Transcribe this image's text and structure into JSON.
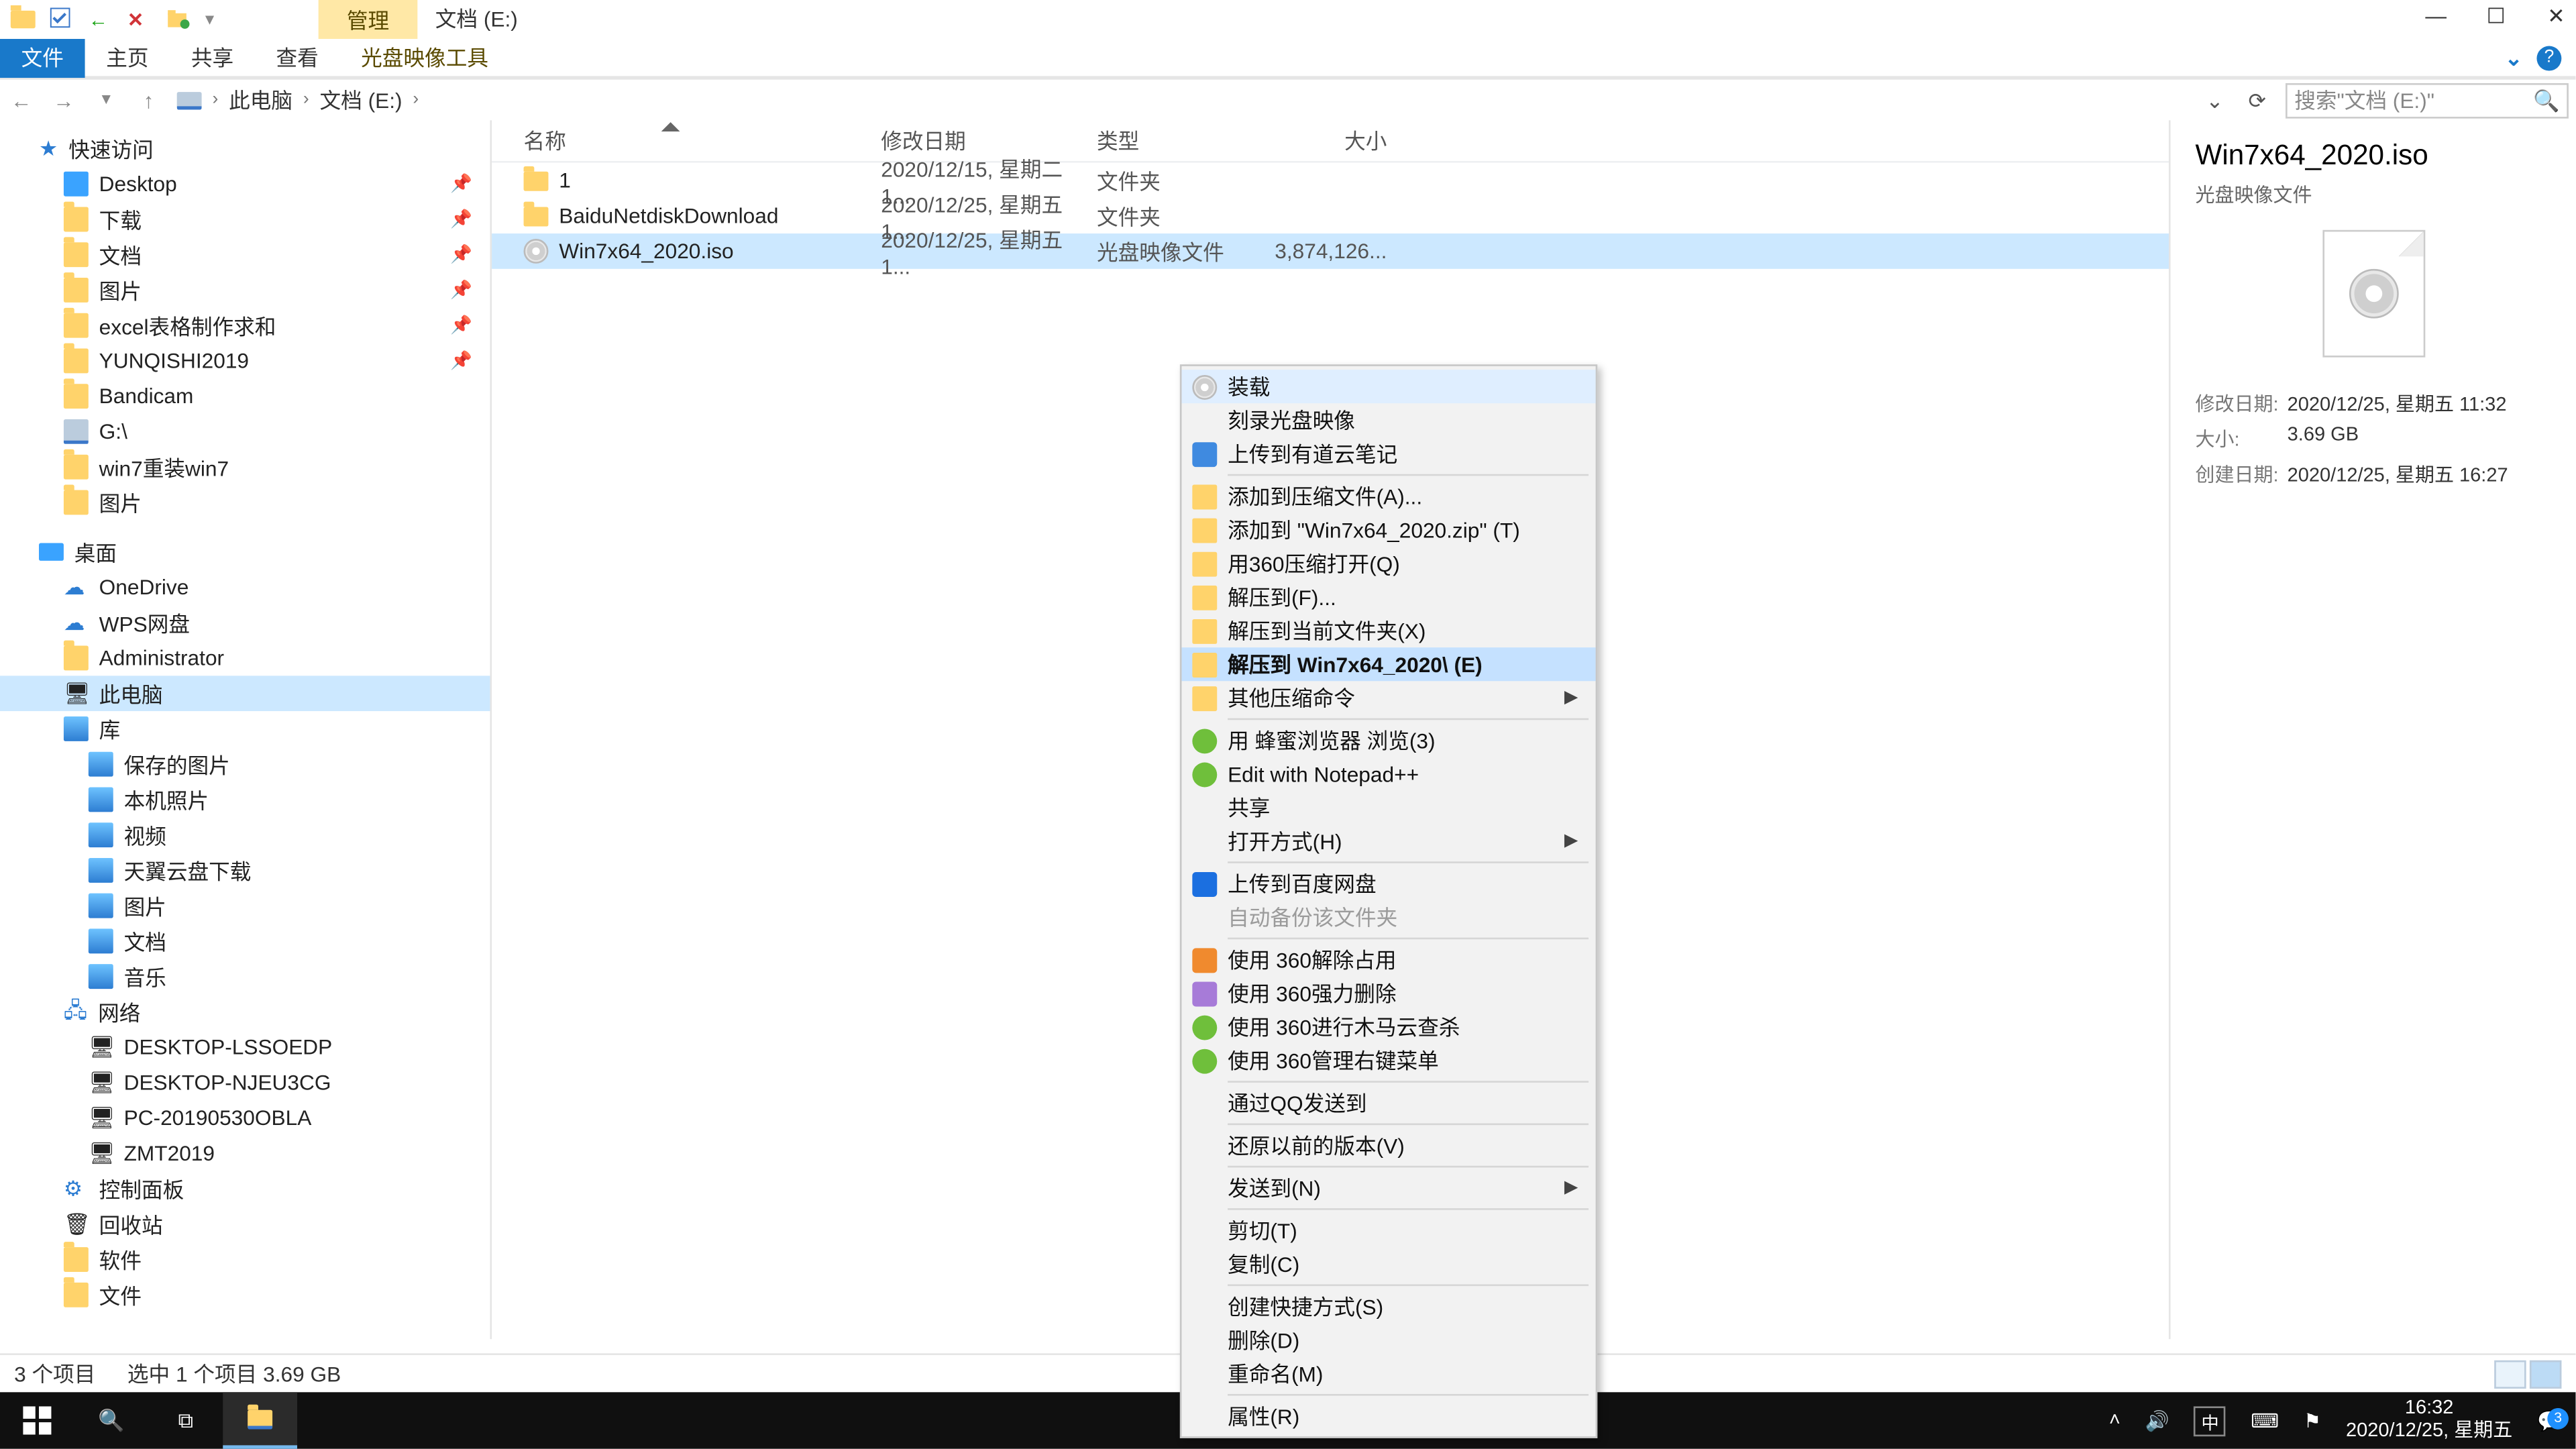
{
  "title": {
    "tool_tab": "管理",
    "location": "文档 (E:)"
  },
  "ribbon": {
    "file": "文件",
    "home": "主页",
    "share": "共享",
    "view": "查看",
    "context": "光盘映像工具"
  },
  "breadcrumb": {
    "root": "此电脑",
    "drive": "文档 (E:)"
  },
  "search": {
    "placeholder": "搜索\"文档 (E:)\""
  },
  "columns": {
    "name": "名称",
    "date": "修改日期",
    "type": "类型",
    "size": "大小"
  },
  "rows": [
    {
      "icon": "folder",
      "name": "1",
      "date": "2020/12/15, 星期二 1...",
      "type": "文件夹",
      "size": ""
    },
    {
      "icon": "folder",
      "name": "BaiduNetdiskDownload",
      "date": "2020/12/25, 星期五 1...",
      "type": "文件夹",
      "size": ""
    },
    {
      "icon": "iso",
      "name": "Win7x64_2020.iso",
      "date": "2020/12/25, 星期五 1...",
      "type": "光盘映像文件",
      "size": "3,874,126...",
      "selected": true
    }
  ],
  "tree": {
    "quick": {
      "label": "快速访问"
    },
    "quick_items": [
      {
        "label": "Desktop",
        "pin": true,
        "icon": "desktop"
      },
      {
        "label": "下载",
        "pin": true,
        "icon": "folder"
      },
      {
        "label": "文档",
        "pin": true,
        "icon": "folder"
      },
      {
        "label": "图片",
        "pin": true,
        "icon": "folder"
      },
      {
        "label": "excel表格制作求和",
        "pin": true,
        "icon": "folder"
      },
      {
        "label": "YUNQISHI2019",
        "pin": true,
        "icon": "folder"
      },
      {
        "label": "Bandicam",
        "pin": false,
        "icon": "folder"
      },
      {
        "label": "G:\\",
        "pin": false,
        "icon": "disk"
      },
      {
        "label": "win7重装win7",
        "pin": false,
        "icon": "folder"
      },
      {
        "label": "图片",
        "pin": false,
        "icon": "folder"
      }
    ],
    "desktop": {
      "label": "桌面"
    },
    "desktop_items": [
      {
        "label": "OneDrive",
        "icon": "cloud"
      },
      {
        "label": "WPS网盘",
        "icon": "cloud"
      },
      {
        "label": "Administrator",
        "icon": "folder"
      },
      {
        "label": "此电脑",
        "icon": "pc",
        "selected": true
      },
      {
        "label": "库",
        "icon": "lib"
      }
    ],
    "lib_items": [
      {
        "label": "保存的图片"
      },
      {
        "label": "本机照片"
      },
      {
        "label": "视频"
      },
      {
        "label": "天翼云盘下载"
      },
      {
        "label": "图片"
      },
      {
        "label": "文档"
      },
      {
        "label": "音乐"
      }
    ],
    "network": {
      "label": "网络"
    },
    "network_items": [
      {
        "label": "DESKTOP-LSSOEDP"
      },
      {
        "label": "DESKTOP-NJEU3CG"
      },
      {
        "label": "PC-20190530OBLA"
      },
      {
        "label": "ZMT2019"
      }
    ],
    "tail": [
      {
        "label": "控制面板",
        "icon": "panel"
      },
      {
        "label": "回收站",
        "icon": "bin"
      },
      {
        "label": "软件",
        "icon": "folder"
      },
      {
        "label": "文件",
        "icon": "folder"
      }
    ]
  },
  "context_menu": [
    {
      "label": "装载",
      "icon": "disc",
      "highlight": true
    },
    {
      "label": "刻录光盘映像"
    },
    {
      "label": "上传到有道云笔记",
      "icon": "blue"
    },
    {
      "sep": true
    },
    {
      "label": "添加到压缩文件(A)...",
      "icon": "generic"
    },
    {
      "label": "添加到 \"Win7x64_2020.zip\" (T)",
      "icon": "generic"
    },
    {
      "label": "用360压缩打开(Q)",
      "icon": "generic"
    },
    {
      "label": "解压到(F)...",
      "icon": "generic"
    },
    {
      "label": "解压到当前文件夹(X)",
      "icon": "generic"
    },
    {
      "label": "解压到 Win7x64_2020\\ (E)",
      "icon": "generic",
      "hover": true
    },
    {
      "label": "其他压缩命令",
      "icon": "generic",
      "submenu": true
    },
    {
      "sep": true
    },
    {
      "label": "用 蜂蜜浏览器 浏览(3)",
      "icon": "green"
    },
    {
      "label": "Edit with Notepad++",
      "icon": "green"
    },
    {
      "label": "共享",
      "icon": "share"
    },
    {
      "label": "打开方式(H)",
      "submenu": true
    },
    {
      "sep": true
    },
    {
      "label": "上传到百度网盘",
      "icon": "baidu"
    },
    {
      "label": "自动备份该文件夹",
      "disabled": true
    },
    {
      "sep": true
    },
    {
      "label": "使用 360解除占用",
      "icon": "orange"
    },
    {
      "label": "使用 360强力删除",
      "icon": "purple"
    },
    {
      "label": "使用 360进行木马云查杀",
      "icon": "green"
    },
    {
      "label": "使用 360管理右键菜单",
      "icon": "green"
    },
    {
      "sep": true
    },
    {
      "label": "通过QQ发送到"
    },
    {
      "sep": true
    },
    {
      "label": "还原以前的版本(V)"
    },
    {
      "sep": true
    },
    {
      "label": "发送到(N)",
      "submenu": true
    },
    {
      "sep": true
    },
    {
      "label": "剪切(T)"
    },
    {
      "label": "复制(C)"
    },
    {
      "sep": true
    },
    {
      "label": "创建快捷方式(S)"
    },
    {
      "label": "删除(D)"
    },
    {
      "label": "重命名(M)"
    },
    {
      "sep": true
    },
    {
      "label": "属性(R)"
    }
  ],
  "preview": {
    "title": "Win7x64_2020.iso",
    "type": "光盘映像文件",
    "props": [
      {
        "k": "修改日期:",
        "v": "2020/12/25, 星期五 11:32"
      },
      {
        "k": "大小:",
        "v": "3.69 GB"
      },
      {
        "k": "创建日期:",
        "v": "2020/12/25, 星期五 16:27"
      }
    ]
  },
  "status": {
    "count": "3 个项目",
    "selection": "选中 1 个项目  3.69 GB"
  },
  "taskbar": {
    "time": "16:32",
    "date": "2020/12/25, 星期五",
    "ime": "中",
    "notif_count": "3"
  }
}
